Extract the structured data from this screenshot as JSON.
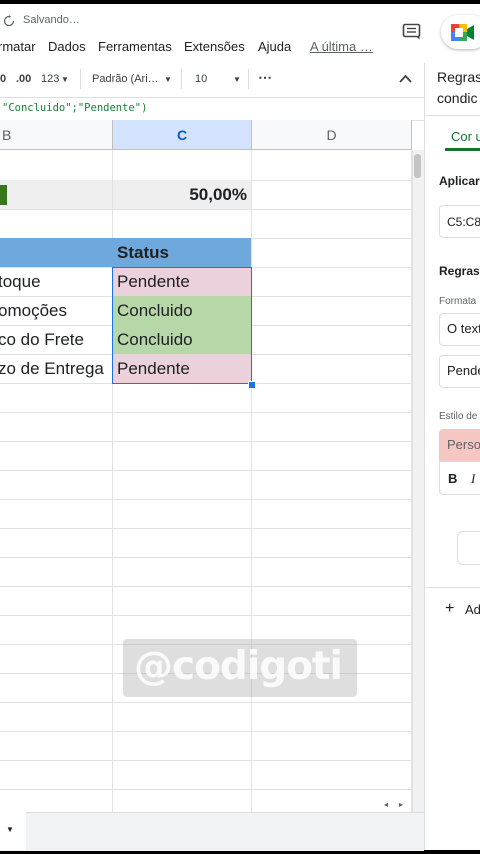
{
  "title_bar": {
    "status": "Salvando…"
  },
  "menu": [
    "rmatar",
    "Dados",
    "Ferramentas",
    "Extensões",
    "Ajuda",
    "A última …"
  ],
  "toolbar": {
    "decimal_decrease": ".0",
    "decimal_increase": ".00",
    "format_123": "123",
    "font_name": "Padrão (Ari…",
    "font_size": "10",
    "more": "⋯"
  },
  "formula": "\"Concluido\";\"Pendente\")",
  "columns": [
    "B",
    "C",
    "D"
  ],
  "percentage": "50,00%",
  "progress": {
    "fill_fraction": 0.5,
    "color": "#38761d"
  },
  "table": {
    "header": "Status",
    "rows": [
      {
        "label": "toque",
        "status": "Pendente",
        "color": "#ead1dc"
      },
      {
        "label": "omoções",
        "status": "Concluido",
        "color": "#b6d7a8"
      },
      {
        "label": "co do Frete",
        "status": "Concluido",
        "color": "#b6d7a8"
      },
      {
        "label": "zo de Entrega",
        "status": "Pendente",
        "color": "#ead1dc"
      }
    ]
  },
  "header_color": "#6fa8dc",
  "panel": {
    "title_line1": "Regras",
    "title_line2": "condic",
    "tab_label": "Cor u",
    "apply_label": "Aplicar",
    "range": "C5:C8",
    "rules_label": "Regras",
    "format_label": "Formata",
    "condition": "O text",
    "value": "Pende",
    "style_label": "Estilo de",
    "style_preview": "Person",
    "bold": "B",
    "italic": "I",
    "add": "Ad"
  },
  "watermark": "@codigoti"
}
